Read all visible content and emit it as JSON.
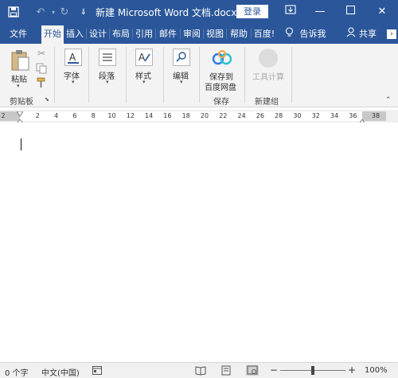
{
  "window": {
    "doc_title": "新建 Microsoft Word 文档.docx...",
    "login_label": "登录",
    "min_glyph": "—",
    "max_glyph": "☐",
    "close_glyph": "✕",
    "restore_glyph": "▫"
  },
  "tabs": [
    {
      "label": "文件"
    },
    {
      "label": "开始"
    },
    {
      "label": "插入"
    },
    {
      "label": "设计"
    },
    {
      "label": "布局"
    },
    {
      "label": "引用"
    },
    {
      "label": "邮件"
    },
    {
      "label": "审阅"
    },
    {
      "label": "视图"
    },
    {
      "label": "帮助"
    },
    {
      "label": "百度!"
    }
  ],
  "tellme": {
    "label": "告诉我"
  },
  "share": {
    "label": "共享"
  },
  "ribbon": {
    "clipboard": {
      "paste_label": "粘贴",
      "group_label": "剪贴板"
    },
    "font": {
      "label": "字体"
    },
    "paragraph": {
      "label": "段落"
    },
    "styles": {
      "label": "样式"
    },
    "editing": {
      "label": "编辑"
    },
    "save": {
      "label_line1": "保存到",
      "label_line2": "百度网盘",
      "group_label": "保存"
    },
    "tools": {
      "label": "工具计算",
      "group_label": "新建组"
    }
  },
  "ruler": {
    "ticks": [
      "2",
      "2",
      "4",
      "6",
      "8",
      "10",
      "12",
      "14",
      "16",
      "18",
      "20",
      "22",
      "24",
      "26",
      "28",
      "30",
      "32",
      "34",
      "36",
      "38"
    ]
  },
  "status": {
    "word_count": "0 个字",
    "language": "中文(中国)",
    "zoom_minus": "−",
    "zoom_plus": "+",
    "zoom_level": "100%"
  },
  "colors": {
    "brand": "#2b579a"
  }
}
